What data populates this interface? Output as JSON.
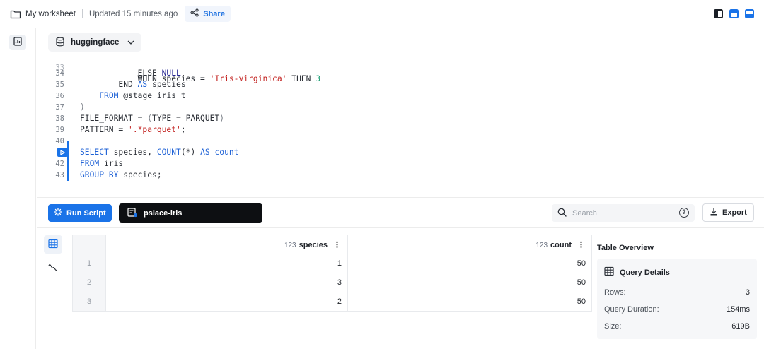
{
  "header": {
    "title": "My worksheet",
    "updated": "Updated 15 minutes ago",
    "share_label": "Share"
  },
  "database": {
    "name": "huggingface"
  },
  "editor": {
    "lines": [
      {
        "n": "34",
        "code": [
          {
            "t": "            ELSE ",
            "c": ""
          },
          {
            "t": "NULL",
            "c": "kd"
          }
        ]
      },
      {
        "n": "35",
        "code": [
          {
            "t": "        END ",
            "c": ""
          },
          {
            "t": "AS",
            "c": "kw"
          },
          {
            "t": " species",
            "c": ""
          }
        ]
      },
      {
        "n": "36",
        "code": [
          {
            "t": "    ",
            "c": ""
          },
          {
            "t": "FROM",
            "c": "kw"
          },
          {
            "t": " @stage_iris t",
            "c": ""
          }
        ]
      },
      {
        "n": "37",
        "code": [
          {
            "t": ")",
            "c": "punct"
          }
        ]
      },
      {
        "n": "38",
        "code": [
          {
            "t": "FILE_FORMAT = ",
            "c": ""
          },
          {
            "t": "(",
            "c": "punct"
          },
          {
            "t": "TYPE = PARQUET",
            "c": ""
          },
          {
            "t": ")",
            "c": "punct"
          }
        ]
      },
      {
        "n": "39",
        "code": [
          {
            "t": "PATTERN = ",
            "c": ""
          },
          {
            "t": "'.*parquet'",
            "c": "str"
          },
          {
            "t": ";",
            "c": ""
          }
        ]
      },
      {
        "n": "40",
        "code": []
      },
      {
        "n": "",
        "code": [
          {
            "t": "SELECT",
            "c": "kw"
          },
          {
            "t": " species, ",
            "c": ""
          },
          {
            "t": "COUNT",
            "c": "kw"
          },
          {
            "t": "(*) ",
            "c": ""
          },
          {
            "t": "AS",
            "c": "kw"
          },
          {
            "t": " ",
            "c": ""
          },
          {
            "t": "count",
            "c": "kw"
          }
        ]
      },
      {
        "n": "42",
        "code": [
          {
            "t": "FROM",
            "c": "kw"
          },
          {
            "t": " iris",
            "c": ""
          }
        ]
      },
      {
        "n": "43",
        "code": [
          {
            "t": "GROUP BY",
            "c": "kw"
          },
          {
            "t": " species;",
            "c": ""
          }
        ]
      }
    ]
  },
  "toolbar": {
    "run_label": "Run Script",
    "warehouse": "psiace-iris",
    "search_placeholder": "Search",
    "export_label": "Export"
  },
  "results": {
    "columns": [
      {
        "type": "123",
        "name": "species"
      },
      {
        "type": "123",
        "name": "count"
      }
    ],
    "rows": [
      {
        "idx": "1",
        "species": "1",
        "count": "50"
      },
      {
        "idx": "2",
        "species": "3",
        "count": "50"
      },
      {
        "idx": "3",
        "species": "2",
        "count": "50"
      }
    ]
  },
  "overview": {
    "title": "Table Overview",
    "card_title": "Query Details",
    "rows": [
      {
        "k": "Rows:",
        "v": "3"
      },
      {
        "k": "Query Duration:",
        "v": "154ms"
      },
      {
        "k": "Size:",
        "v": "619B"
      }
    ]
  },
  "colors": {
    "accent": "#1a73e8",
    "warehouse_bg": "#0d0f12",
    "keyword": "#1f62d6",
    "string": "#c2201e"
  }
}
